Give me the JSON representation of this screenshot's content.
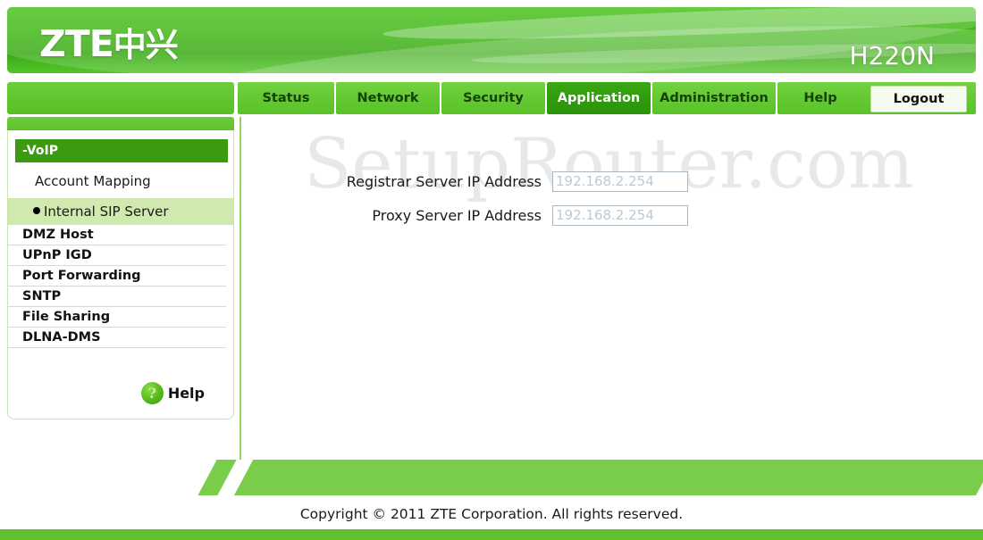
{
  "header": {
    "logo_text": "ZTE",
    "logo_cn": "中兴",
    "model": "H220N"
  },
  "nav": {
    "tabs": [
      {
        "label": "Status",
        "active": false
      },
      {
        "label": "Network",
        "active": false
      },
      {
        "label": "Security",
        "active": false
      },
      {
        "label": "Application",
        "active": true
      },
      {
        "label": "Administration",
        "active": false
      },
      {
        "label": "Help",
        "active": false
      }
    ],
    "logout_label": "Logout"
  },
  "sidebar": {
    "group_header": "-VoIP",
    "sub_items": [
      {
        "label": "Account Mapping",
        "selected": false
      },
      {
        "label": "Internal SIP Server",
        "selected": true
      }
    ],
    "menu_items": [
      {
        "label": "DMZ Host"
      },
      {
        "label": "UPnP IGD"
      },
      {
        "label": "Port Forwarding"
      },
      {
        "label": "SNTP"
      },
      {
        "label": "File Sharing"
      },
      {
        "label": "DLNA-DMS"
      }
    ],
    "help_label": "Help",
    "help_icon": "question-mark-icon"
  },
  "content": {
    "watermark": "SetupRouter.com",
    "fields": [
      {
        "label": "Registrar Server IP Address",
        "value": "192.168.2.254",
        "placeholder": "192.168.2.254"
      },
      {
        "label": "Proxy Server IP Address",
        "value": "192.168.2.254",
        "placeholder": "192.168.2.254"
      }
    ]
  },
  "footer": {
    "copyright": "Copyright © 2011 ZTE Corporation. All rights reserved."
  },
  "colors": {
    "brand_green": "#3fb516",
    "nav_green": "#63c831",
    "active_tab_green": "#2f9a0c",
    "selected_item_green": "#cfe9ae",
    "footer_green": "#79cd4a"
  }
}
